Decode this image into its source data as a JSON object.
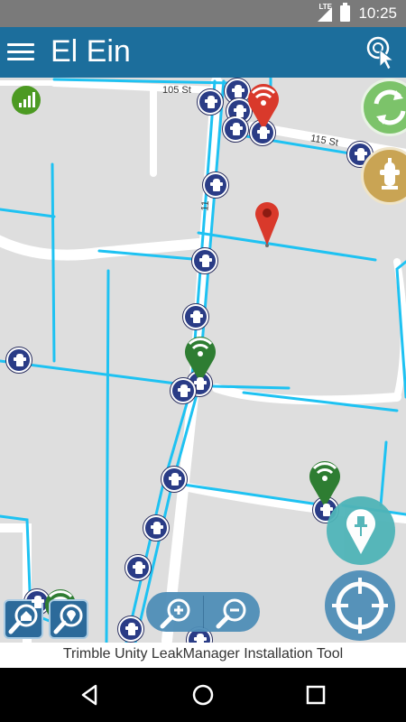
{
  "status_bar": {
    "network": "LTE",
    "time": "10:25"
  },
  "app_bar": {
    "title": "El Ein",
    "menu_icon": "hamburger-menu-icon",
    "select_icon": "touch-select-icon"
  },
  "map": {
    "streets": {
      "s105": "105 St",
      "s115": "115 St",
      "s11": "11"
    },
    "signal_icon": "signal-strength-icon",
    "colors": {
      "pipe": "#1ec2f2",
      "road": "#ffffff",
      "ground": "#dedede",
      "hydrant": "#2a3c86",
      "leak_red": "#d9392b",
      "sensor_green": "#2e7d32"
    }
  },
  "buttons": {
    "refresh_icon": "refresh-icon",
    "hydrant_layer_icon": "hydrant-icon",
    "drop_pin_icon": "drop-pin-icon",
    "locate_icon": "crosshair-icon",
    "zoom_in_icon": "zoom-in-icon",
    "zoom_out_icon": "zoom-out-icon",
    "zoom_home_icon": "zoom-home-icon",
    "zoom_sensor_icon": "zoom-sensor-icon"
  },
  "footer": {
    "text": "Trimble Unity LeakManager Installation Tool"
  },
  "nav_bar": {
    "back": "back-icon",
    "home": "home-icon",
    "recents": "recents-icon"
  }
}
